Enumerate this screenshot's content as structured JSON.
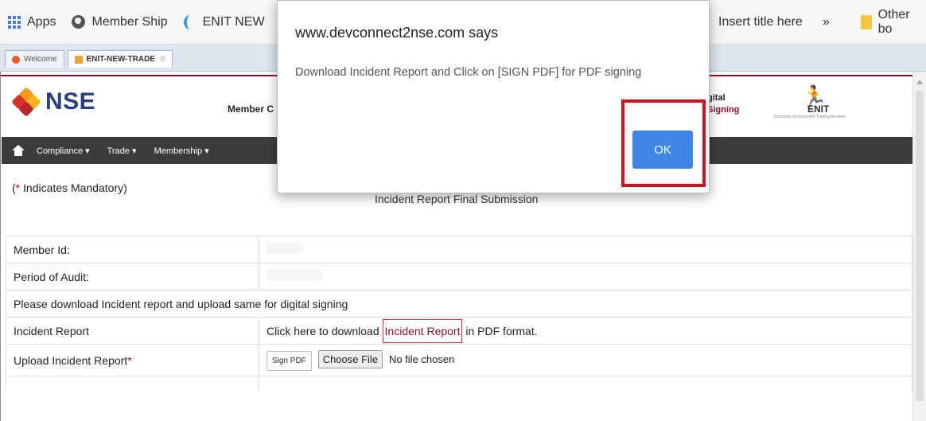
{
  "bookmarks": {
    "apps": "Apps",
    "membership": "Member Ship",
    "enit_new": "ENIT NEW",
    "insert_title": "Insert title here",
    "more": "»",
    "other": "Other bo"
  },
  "tabs": [
    {
      "label": "Welcome"
    },
    {
      "label": "ENIT-NEW-TRADE"
    }
  ],
  "header": {
    "logo_text": "NSE",
    "member_text": "Member C",
    "digital_line1": "gital",
    "digital_line2": "Signing",
    "enit_brand": "ENIT",
    "enit_tagline": "Electronic Enforcement Trading Member"
  },
  "nav": {
    "items": [
      "Compliance ▾",
      "Trade ▾",
      "Membership ▾"
    ]
  },
  "form": {
    "mandatory_prefix": "(",
    "mandatory_star": "*",
    "mandatory_text": " Indicates Mandatory)",
    "subtitle": "Incident Report Final Submission",
    "member_id_label": "Member Id:",
    "period_label": "Period of Audit:",
    "instruction": "Please download Incident report and upload same for digital signing",
    "incident_label": "Incident Report",
    "download_prefix": "Click here to download ",
    "download_link": "Incident Report",
    "download_suffix": " in PDF format.",
    "upload_label": "Upload Incident Report",
    "upload_required": "*",
    "sign_pdf": "Sign PDF",
    "choose_file": "Choose File",
    "no_file": "No file chosen"
  },
  "dialog": {
    "origin": "www.devconnect2nse.com says",
    "message": "Download Incident Report and Click on [SIGN PDF] for PDF signing",
    "ok": "OK"
  }
}
